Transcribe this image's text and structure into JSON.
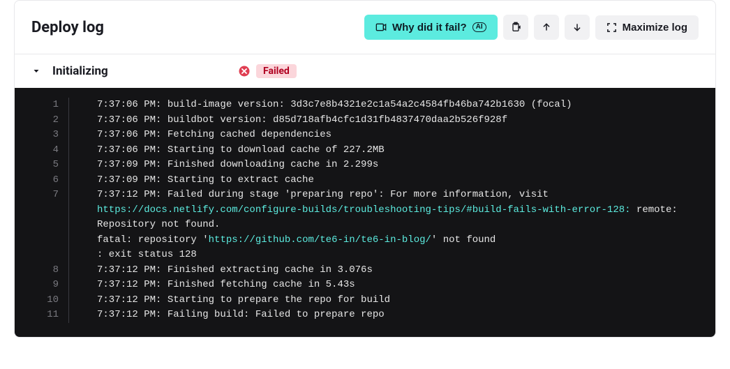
{
  "header": {
    "title": "Deploy log",
    "why_label": "Why did it fail?",
    "ai_badge": "AI",
    "maximize_label": "Maximize log"
  },
  "section": {
    "title": "Initializing",
    "status_label": "Failed"
  },
  "log": {
    "lines": [
      {
        "n": "1",
        "segments": [
          {
            "t": "text",
            "v": "7:37:06 PM: build-image version: 3d3c7e8b4321e2c1a54a2c4584fb46ba742b1630 (focal)"
          }
        ]
      },
      {
        "n": "2",
        "segments": [
          {
            "t": "text",
            "v": "7:37:06 PM: buildbot version: d85d718afb4cfc1d31fb4837470daa2b526f928f"
          }
        ]
      },
      {
        "n": "3",
        "segments": [
          {
            "t": "text",
            "v": "7:37:06 PM: Fetching cached dependencies"
          }
        ]
      },
      {
        "n": "4",
        "segments": [
          {
            "t": "text",
            "v": "7:37:06 PM: Starting to download cache of 227.2MB"
          }
        ]
      },
      {
        "n": "5",
        "segments": [
          {
            "t": "text",
            "v": "7:37:09 PM: Finished downloading cache in 2.299s"
          }
        ]
      },
      {
        "n": "6",
        "segments": [
          {
            "t": "text",
            "v": "7:37:09 PM: Starting to extract cache"
          }
        ]
      },
      {
        "n": "7",
        "segments": [
          {
            "t": "text",
            "v": "7:37:12 PM: Failed during stage 'preparing repo': For more information, visit "
          },
          {
            "t": "link",
            "v": "https://docs.netlify.com/configure-builds/troubleshooting-tips/#build-fails-with-error-128:"
          },
          {
            "t": "text",
            "v": " remote: Repository not found.\nfatal: repository '"
          },
          {
            "t": "link",
            "v": "https://github.com/te6-in/te6-in-blog/"
          },
          {
            "t": "text",
            "v": "' not found\n: exit status 128"
          }
        ]
      },
      {
        "n": "8",
        "segments": [
          {
            "t": "text",
            "v": "7:37:12 PM: Finished extracting cache in 3.076s"
          }
        ]
      },
      {
        "n": "9",
        "segments": [
          {
            "t": "text",
            "v": "7:37:12 PM: Finished fetching cache in 5.43s"
          }
        ]
      },
      {
        "n": "10",
        "segments": [
          {
            "t": "text",
            "v": "7:37:12 PM: Starting to prepare the repo for build"
          }
        ]
      },
      {
        "n": "11",
        "segments": [
          {
            "t": "text",
            "v": "7:37:12 PM: Failing build: Failed to prepare repo"
          }
        ]
      }
    ]
  }
}
